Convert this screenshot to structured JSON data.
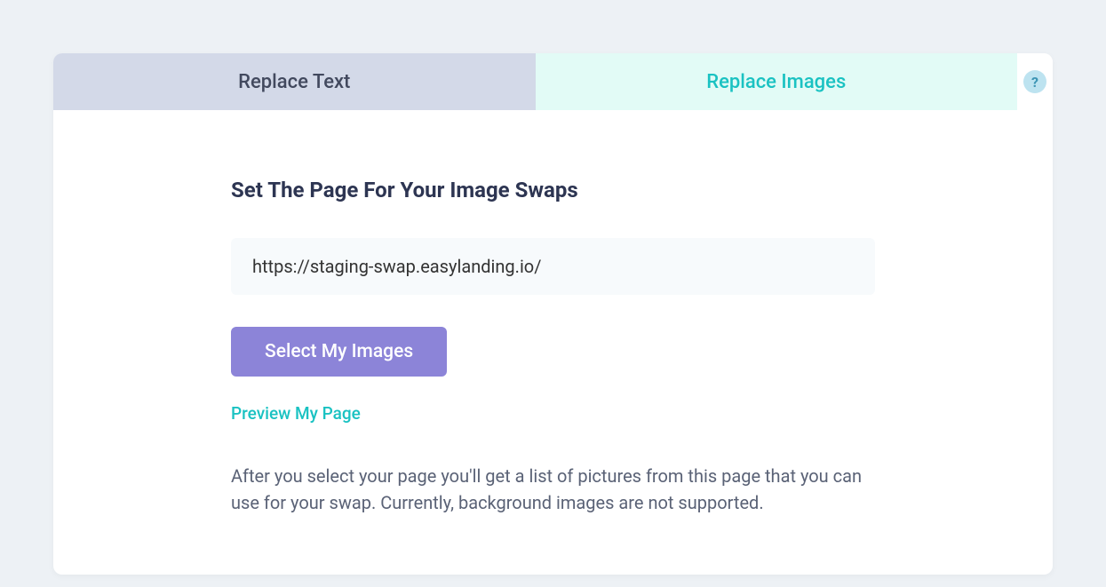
{
  "tabs": {
    "replace_text": "Replace Text",
    "replace_images": "Replace Images",
    "help": "?"
  },
  "content": {
    "heading": "Set The Page For Your Image Swaps",
    "url_value": "https://staging-swap.easylanding.io/",
    "select_button": "Select My Images",
    "preview_link": "Preview My Page",
    "helper_text": "After you select your page you'll get a list of pictures from this page that you can use for your swap. Currently, background images are not supported."
  }
}
